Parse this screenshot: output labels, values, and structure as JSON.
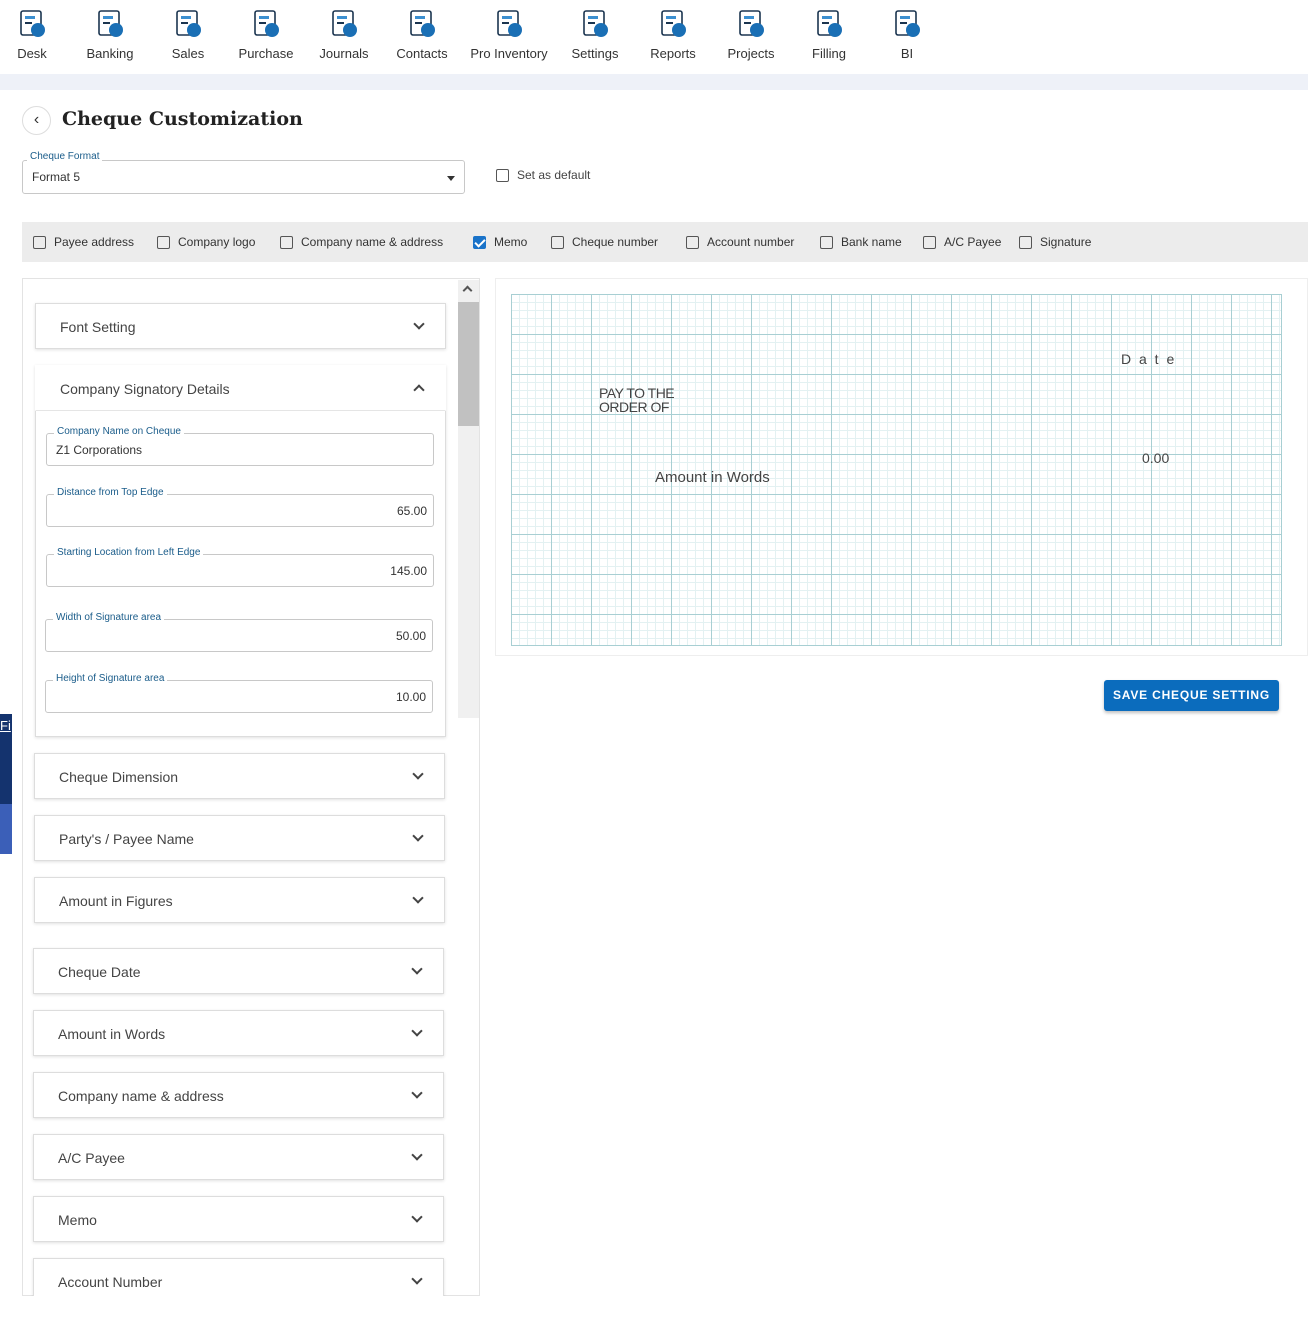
{
  "nav": [
    {
      "label": "Desk",
      "icon": "desk-icon"
    },
    {
      "label": "Banking",
      "icon": "bank-icon"
    },
    {
      "label": "Sales",
      "icon": "sales-icon"
    },
    {
      "label": "Purchase",
      "icon": "purchase-icon"
    },
    {
      "label": "Journals",
      "icon": "journals-icon"
    },
    {
      "label": "Contacts",
      "icon": "contacts-icon"
    },
    {
      "label": "Pro Inventory",
      "icon": "inventory-icon"
    },
    {
      "label": "Settings",
      "icon": "settings-icon"
    },
    {
      "label": "Reports",
      "icon": "reports-icon"
    },
    {
      "label": "Projects",
      "icon": "projects-icon"
    },
    {
      "label": "Filling",
      "icon": "filling-icon"
    },
    {
      "label": "BI",
      "icon": "bi-icon"
    }
  ],
  "page": {
    "title": "Cheque Customization",
    "back_icon": "chevron-left-icon"
  },
  "format": {
    "label": "Cheque Format",
    "value": "Format 5",
    "default_label": "Set as default",
    "default_checked": false
  },
  "options": [
    {
      "label": "Payee address",
      "checked": false
    },
    {
      "label": "Company logo",
      "checked": false
    },
    {
      "label": "Company name & address",
      "checked": false
    },
    {
      "label": "Memo",
      "checked": true
    },
    {
      "label": "Cheque number",
      "checked": false
    },
    {
      "label": "Account number",
      "checked": false
    },
    {
      "label": "Bank name",
      "checked": false
    },
    {
      "label": "A/C Payee",
      "checked": false
    },
    {
      "label": "Signature",
      "checked": false
    }
  ],
  "sections": {
    "font": "Font Setting",
    "signatory": {
      "title": "Company Signatory Details",
      "fields": [
        {
          "label": "Company Name on Cheque",
          "value": "Z1 Corporations"
        },
        {
          "label": "Distance from Top Edge",
          "value": "65.00"
        },
        {
          "label": "Starting Location from Left Edge",
          "value": "145.00"
        },
        {
          "label": "Width of Signature area",
          "value": "50.00"
        },
        {
          "label": "Height of Signature area",
          "value": "10.00"
        }
      ]
    },
    "collapsed": [
      "Cheque Dimension",
      "Party's / Payee Name",
      "Amount in Figures",
      "Cheque Date",
      "Amount in Words",
      "Company name & address",
      "A/C Payee",
      "Memo",
      "Account Number"
    ]
  },
  "preview": {
    "date": "D a t e",
    "pay_to": "PAY TO THE",
    "order_of": "ORDER OF",
    "amount": "0.00",
    "amount_words": "Amount in Words"
  },
  "save_label": "SAVE CHEQUE SETTING",
  "background_fragment": "Fi",
  "colors": {
    "accent": "#0b6cbd",
    "grid": "#a8cfd3",
    "checkbox": "#1a73c9"
  }
}
